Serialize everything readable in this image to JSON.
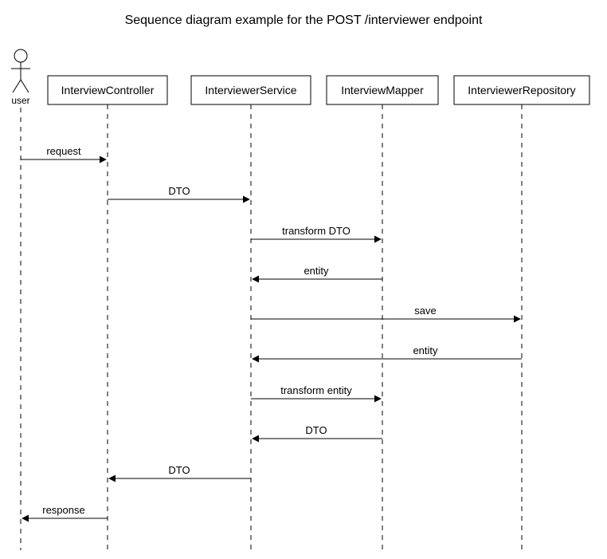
{
  "title": "Sequence diagram example for the POST /interviewer endpoint",
  "actor": {
    "label": "user"
  },
  "participants": {
    "controller": "InterviewController",
    "service": "InterviewerService",
    "mapper": "InterviewMapper",
    "repository": "InterviewerRepository"
  },
  "messages": {
    "m1": "request",
    "m2": "DTO",
    "m3": "transform DTO",
    "m4": "entity",
    "m5": "save",
    "m6": "entity",
    "m7": "transform entity",
    "m8": "DTO",
    "m9": "DTO",
    "m10": "response"
  }
}
